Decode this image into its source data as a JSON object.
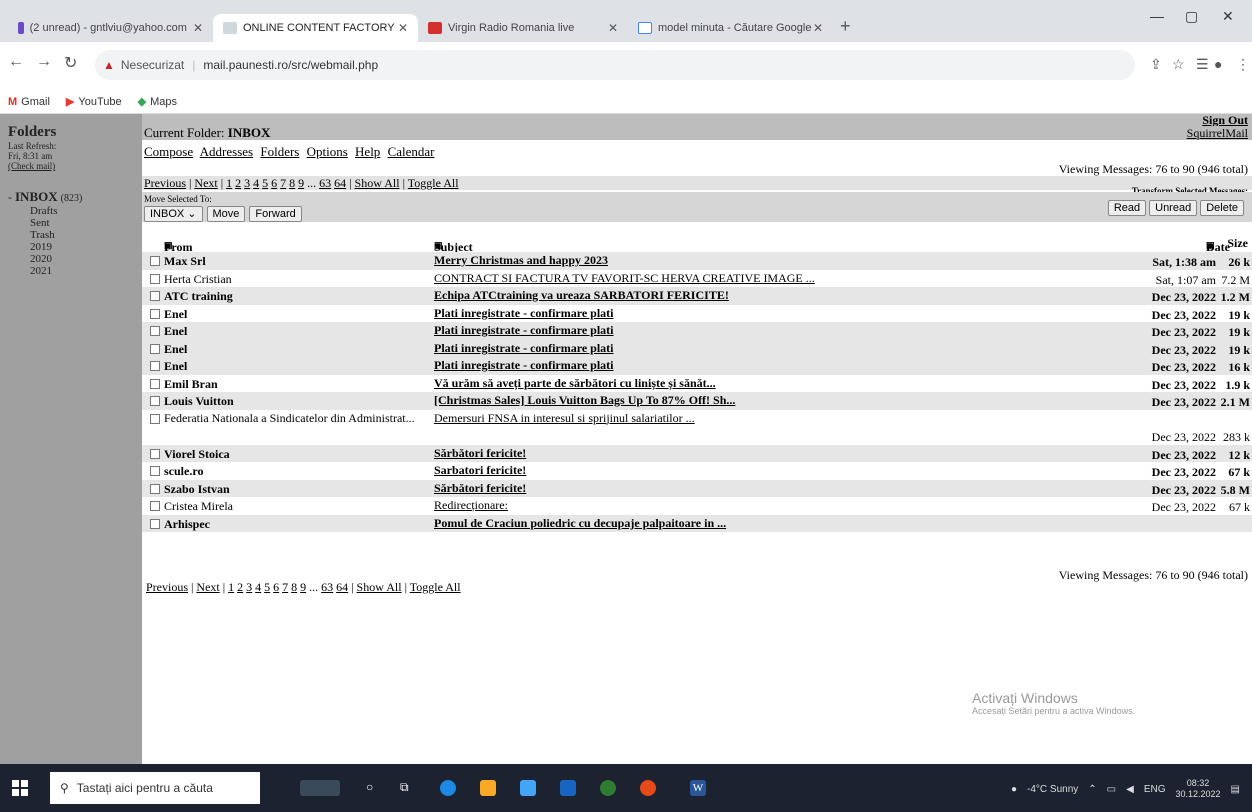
{
  "browser": {
    "tabs": [
      {
        "label": "(2 unread) - gntlviu@yahoo.com",
        "close": "✕"
      },
      {
        "label": "ONLINE CONTENT FACTORY",
        "close": "✕"
      },
      {
        "label": "Virgin Radio Romania live",
        "close": "✕"
      },
      {
        "label": "model minuta - Căutare Google",
        "close": "✕"
      }
    ],
    "new_tab": "+",
    "insecure_label": "Nesecurizat",
    "url": "mail.paunesti.ro/src/webmail.php",
    "bookmarks": [
      {
        "icon": "M",
        "label": "Gmail"
      },
      {
        "icon": "▶",
        "label": "YouTube"
      },
      {
        "icon": "◆",
        "label": "Maps"
      }
    ]
  },
  "sidebar": {
    "title": "Folders",
    "last_refresh_label": "Last Refresh:",
    "last_refresh_time": "Fri, 8:31 am",
    "check_mail": "(Check mail)",
    "inbox_label": "INBOX",
    "inbox_count": "(823)",
    "folders": [
      "Drafts",
      "Sent",
      "Trash",
      "2019",
      "2020",
      "2021"
    ]
  },
  "main": {
    "sign_out": "Sign Out",
    "current_folder_label": "Current Folder:",
    "current_folder": "INBOX",
    "brand": "SquirrelMail",
    "menu": [
      "Compose",
      "Addresses",
      "Folders",
      "Options",
      "Help",
      "Calendar"
    ],
    "viewing": "Viewing Messages: 76 to 90 (946 total)",
    "pager": {
      "previous": "Previous",
      "next": "Next",
      "pages": [
        "1",
        "2",
        "3",
        "4",
        "5",
        "6",
        "7",
        "8",
        "9"
      ],
      "ellipsis": "...",
      "last_pages": [
        "63",
        "64"
      ],
      "show_all": "Show All",
      "toggle_all": "Toggle All"
    },
    "transform_label": "Transform Selected Messages:",
    "move_label": "Move Selected To:",
    "move_folder": "INBOX",
    "move_button": "Move",
    "forward_button": "Forward",
    "read_button": "Read",
    "unread_button": "Unread",
    "delete_button": "Delete",
    "headers": {
      "from": "From",
      "subject": "Subject",
      "date": "Date",
      "size": "Size"
    },
    "messages": [
      {
        "from": "Max Srl",
        "subject": "Merry Christmas and happy 2023",
        "date": "Sat, 1:38 am",
        "size": "26 k",
        "unread": true
      },
      {
        "from": "Herta Cristian",
        "subject": "CONTRACT SI FACTURA TV FAVORIT-SC HERVA CREATIVE IMAGE ...",
        "date": "Sat, 1:07 am",
        "size": "7.2 M",
        "unread": false
      },
      {
        "from": "ATC training",
        "subject": "Echipa ATCtraining va ureaza SARBATORI FERICITE!",
        "date": "Dec 23, 2022",
        "size": "1.2 M",
        "unread": true
      },
      {
        "from": "Enel",
        "subject": "Plati inregistrate - confirmare plati",
        "date": "Dec 23, 2022",
        "size": "19 k",
        "unread": true
      },
      {
        "from": "Enel",
        "subject": "Plati inregistrate - confirmare plati",
        "date": "Dec 23, 2022",
        "size": "19 k",
        "unread": true
      },
      {
        "from": "Enel",
        "subject": "Plati inregistrate - confirmare plati",
        "date": "Dec 23, 2022",
        "size": "19 k",
        "unread": true
      },
      {
        "from": "Enel",
        "subject": "Plati inregistrate - confirmare plati",
        "date": "Dec 23, 2022",
        "size": "16 k",
        "unread": true
      },
      {
        "from": "Emil Bran",
        "subject": "Vă urăm să aveți parte de sărbători cu liniște și sănăt...",
        "date": "Dec 23, 2022",
        "size": "1.9 k",
        "unread": true
      },
      {
        "from": "Louis Vuitton",
        "subject": "[Christmas Sales] Louis Vuitton Bags Up To 87% Off! Sh...",
        "date": "Dec 23, 2022",
        "size": "2.1 M",
        "unread": true
      },
      {
        "from": "Federatia Nationala a Sindicatelor din Administrat...",
        "subject": "Demersuri FNSA in interesul si sprijinul salariatilor ...",
        "date": "Dec 23, 2022",
        "size": "283 k",
        "unread": false
      },
      {
        "from": "Viorel Stoica",
        "subject": "Sărbători fericite!",
        "date": "Dec 23, 2022",
        "size": "12 k",
        "unread": true
      },
      {
        "from": "scule.ro",
        "subject": "Sarbatori fericite!",
        "date": "Dec 23, 2022",
        "size": "67 k",
        "unread": true
      },
      {
        "from": "Szabo Istvan",
        "subject": "Sărbători fericite!",
        "date": "Dec 23, 2022",
        "size": "5.8 M",
        "unread": true
      },
      {
        "from": "Cristea Mirela",
        "subject": "Redirecționare:",
        "date": "Dec 23, 2022",
        "size": "67 k",
        "unread": false
      },
      {
        "from": "Arhispec",
        "subject": "Pomul de Craciun poliedric cu decupaje palpaitoare in ...",
        "date": "",
        "size": "",
        "unread": true
      }
    ]
  },
  "watermark": {
    "title": "Activați Windows",
    "subtitle": "Accesați Setări pentru a activa Windows."
  },
  "taskbar": {
    "search_placeholder": "Tastați aici pentru a căuta",
    "weather": "-4°C Sunny",
    "lang": "ENG",
    "time": "08:32",
    "date": "30.12.2022"
  }
}
